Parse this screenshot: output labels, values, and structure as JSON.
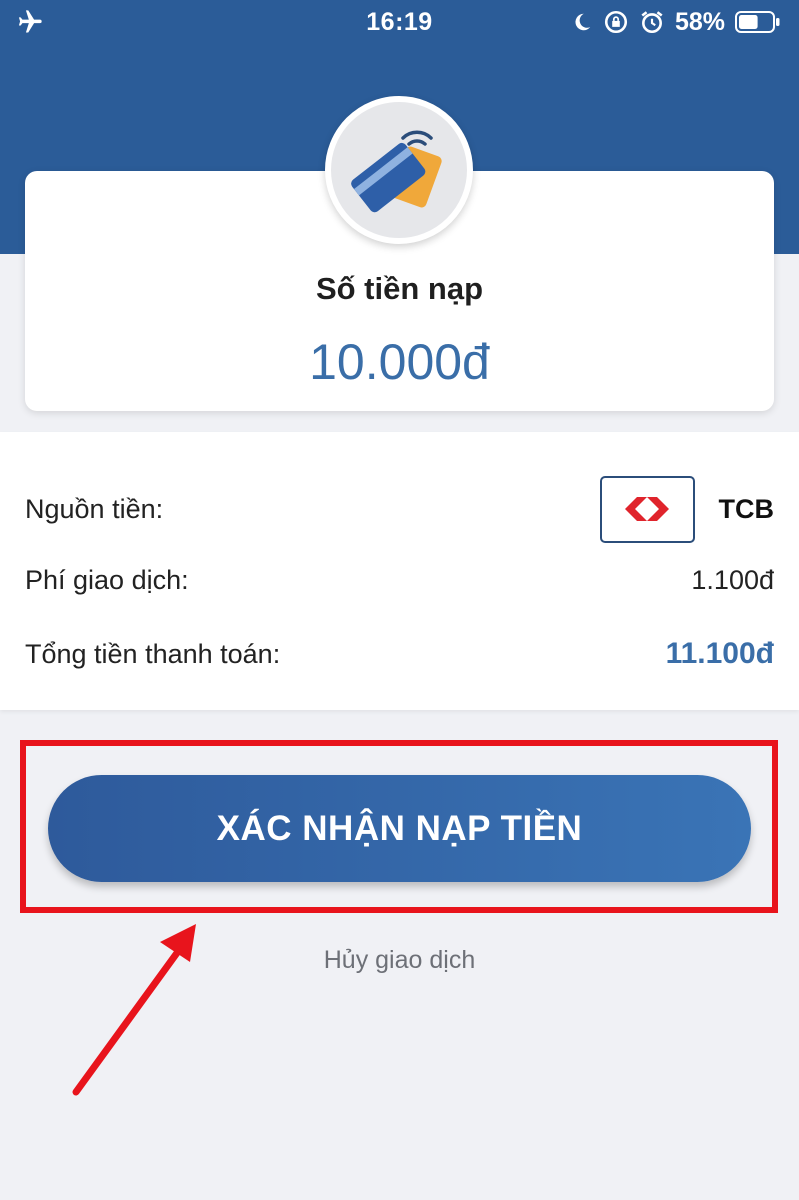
{
  "status_bar": {
    "time": "16:19",
    "battery_percent": "58%",
    "icons": [
      "airplane-icon",
      "moon-icon",
      "rotation-lock-icon",
      "alarm-icon",
      "battery-icon"
    ],
    "battery_level": 0.58
  },
  "summary": {
    "amount_label": "Số tiền nạp",
    "amount_value": "10.000đ",
    "logo_icon": "wallet-cards-icon"
  },
  "details": {
    "source_label": "Nguồn tiền:",
    "source_bank": "TCB",
    "bank_logo_icon": "techcombank-logo-icon",
    "fee_label": "Phí giao dịch:",
    "fee_value": "1.100đ",
    "total_label": "Tổng tiền thanh toán:",
    "total_value": "11.100đ"
  },
  "actions": {
    "confirm_label": "XÁC NHẬN NẠP TIỀN",
    "cancel_label": "Hủy giao dịch"
  },
  "colors": {
    "header": "#2b5c98",
    "accent": "#3a6ea8",
    "annotation": "#e8141c",
    "background": "#f0f1f5"
  }
}
